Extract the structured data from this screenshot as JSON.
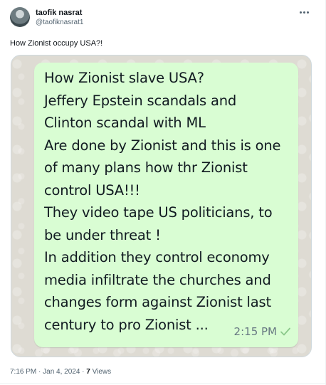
{
  "author": {
    "display_name": "taofik nasrat",
    "handle": "@taofiknasrat1"
  },
  "tweet": {
    "text": "How Zionist occupy USA?!"
  },
  "screenshot": {
    "lines": [
      "How Zionist slave USA?",
      "Jeffery Epstein scandals and",
      "Clinton scandal with ML",
      "Are done by Zionist and this is one",
      "of many plans how thr Zionist",
      "control USA!!!",
      "They video tape US politicians, to",
      "be under threat !",
      "In addition they control economy",
      "media infiltrate the churches and",
      "changes form against Zionist last",
      "century to pro Zionist ..."
    ],
    "time": "2:15 PM",
    "status_icon": "check-icon",
    "bubble_color": "#d9fdd3",
    "check_color": "#8bc98b"
  },
  "footer": {
    "timestamp": "7:16 PM · Jan 4, 2024 · ",
    "views_count": "7",
    "views_label": " Views"
  }
}
